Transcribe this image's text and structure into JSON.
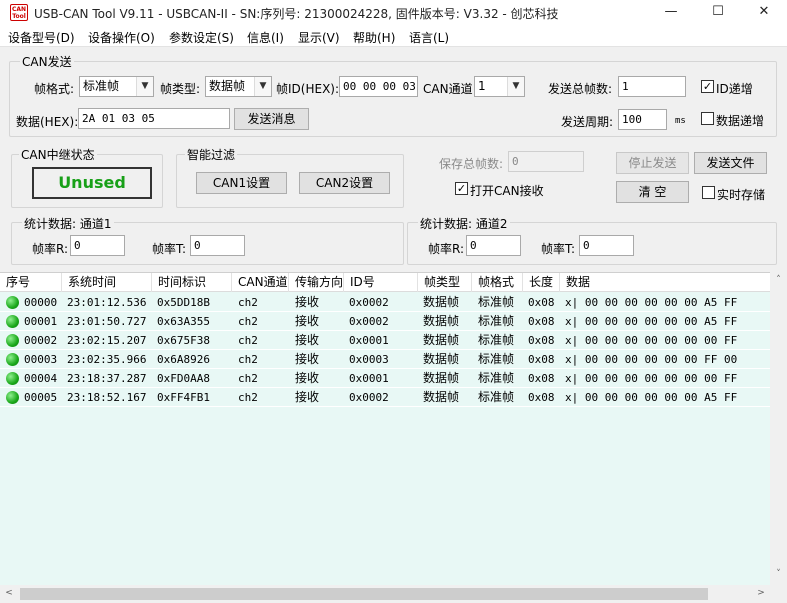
{
  "window": {
    "title": "USB-CAN Tool V9.11 - USBCAN-II - SN:序列号: 21300024228, 固件版本号: V3.32 - 创芯科技",
    "icon_text": "CAN\nTool",
    "minimize": "—",
    "maximize": "☐",
    "close": "✕"
  },
  "menu": [
    "设备型号(D)",
    "设备操作(O)",
    "参数设定(S)",
    "信息(I)",
    "显示(V)",
    "帮助(H)",
    "语言(L)"
  ],
  "can_send": {
    "title": "CAN发送",
    "frame_format_label": "帧格式:",
    "frame_format_value": "标准帧",
    "frame_type_label": "帧类型:",
    "frame_type_value": "数据帧",
    "frame_id_label": "帧ID(HEX):",
    "frame_id_value": "00 00 00 03",
    "channel_label": "CAN通道:",
    "channel_value": "1",
    "total_frames_label": "发送总帧数:",
    "total_frames_value": "1",
    "id_increment_label": "ID递增",
    "id_increment_checked": true,
    "data_label": "数据(HEX):",
    "data_value": "2A 01 03 05",
    "send_button": "发送消息",
    "period_label": "发送周期:",
    "period_value": "100",
    "period_unit": "ms",
    "data_increment_label": "数据递增",
    "data_increment_checked": false
  },
  "relay": {
    "title": "CAN中继状态",
    "status": "Unused",
    "status_color": "#18a018"
  },
  "filter": {
    "title": "智能过滤",
    "can1_button": "CAN1设置",
    "can2_button": "CAN2设置"
  },
  "save": {
    "saved_frames_label": "保存总帧数:",
    "saved_frames_value": "0",
    "open_can_receive_label": "打开CAN接收",
    "open_can_receive_checked": true,
    "stop_send_button": "停止发送",
    "send_file_button": "发送文件",
    "clear_button": "清 空",
    "realtime_save_label": "实时存储",
    "realtime_save_checked": false
  },
  "stats1": {
    "title": "统计数据: 通道1",
    "rate_r_label": "帧率R:",
    "rate_r_value": "0",
    "rate_t_label": "帧率T:",
    "rate_t_value": "0"
  },
  "stats2": {
    "title": "统计数据: 通道2",
    "rate_r_label": "帧率R:",
    "rate_r_value": "0",
    "rate_t_label": "帧率T:",
    "rate_t_value": "0"
  },
  "table": {
    "columns": [
      "序号",
      "系统时间",
      "时间标识",
      "CAN通道",
      "传输方向",
      "ID号",
      "帧类型",
      "帧格式",
      "长度",
      "数据"
    ],
    "rows": [
      [
        "00000",
        "23:01:12.536",
        "0x5DD18B",
        "ch2",
        "接收",
        "0x0002",
        "数据帧",
        "标准帧",
        "0x08",
        "x| 00 00 00 00 00 00 A5 FF"
      ],
      [
        "00001",
        "23:01:50.727",
        "0x63A355",
        "ch2",
        "接收",
        "0x0002",
        "数据帧",
        "标准帧",
        "0x08",
        "x| 00 00 00 00 00 00 A5 FF"
      ],
      [
        "00002",
        "23:02:15.207",
        "0x675F38",
        "ch2",
        "接收",
        "0x0001",
        "数据帧",
        "标准帧",
        "0x08",
        "x| 00 00 00 00 00 00 00 FF"
      ],
      [
        "00003",
        "23:02:35.966",
        "0x6A8926",
        "ch2",
        "接收",
        "0x0003",
        "数据帧",
        "标准帧",
        "0x08",
        "x| 00 00 00 00 00 00 FF 00"
      ],
      [
        "00004",
        "23:18:37.287",
        "0xFD0AA8",
        "ch2",
        "接收",
        "0x0001",
        "数据帧",
        "标准帧",
        "0x08",
        "x| 00 00 00 00 00 00 00 FF"
      ],
      [
        "00005",
        "23:18:52.167",
        "0xFF4FB1",
        "ch2",
        "接收",
        "0x0002",
        "数据帧",
        "标准帧",
        "0x08",
        "x| 00 00 00 00 00 00 A5 FF"
      ]
    ]
  },
  "scrollbar": {
    "up": "˄",
    "down": "˅",
    "left": "<",
    "right": ">"
  },
  "icons": {
    "check": "✓",
    "dropdown": "▼"
  },
  "colors": {
    "table_bg": "#e8f8f5",
    "status_green": "#18a018",
    "row_indicator": "#1aa81a"
  }
}
